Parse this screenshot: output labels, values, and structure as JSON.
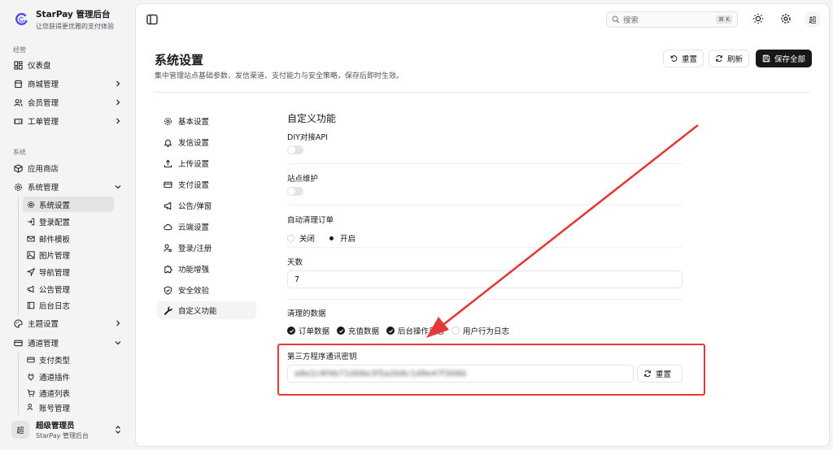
{
  "brand": {
    "name": "StarPay 管理后台",
    "tagline": "让您获得更优雅的支付体验"
  },
  "sidebar": {
    "sections": [
      {
        "label": "经营"
      },
      {
        "label": "系统"
      }
    ],
    "items": [
      {
        "label": "仪表盘",
        "icon": "dashboard-icon"
      },
      {
        "label": "商城管理",
        "icon": "store-icon"
      },
      {
        "label": "会员管理",
        "icon": "users-icon"
      },
      {
        "label": "工单管理",
        "icon": "ticket-icon"
      },
      {
        "label": "应用商店",
        "icon": "package-icon"
      },
      {
        "label": "系统管理",
        "icon": "gear-icon"
      },
      {
        "label": "主题设置",
        "icon": "palette-icon"
      },
      {
        "label": "通道管理",
        "icon": "credit-card-icon"
      }
    ],
    "system_sub": [
      {
        "label": "系统设置"
      },
      {
        "label": "登录配置"
      },
      {
        "label": "邮件模板"
      },
      {
        "label": "图片管理"
      },
      {
        "label": "导航管理"
      },
      {
        "label": "公告管理"
      },
      {
        "label": "后台日志"
      }
    ],
    "channel_sub": [
      {
        "label": "支付类型"
      },
      {
        "label": "通道插件"
      },
      {
        "label": "通道列表"
      },
      {
        "label": "账号管理"
      }
    ],
    "user": {
      "avatar": "超",
      "name": "超级管理员",
      "sub": "StarPay 管理后台"
    }
  },
  "topbar": {
    "search_placeholder": "搜索",
    "shortcut": "⌘ K",
    "avatar": "超"
  },
  "page": {
    "title": "系统设置",
    "description": "集中管理站点基础参数、发信渠道、支付能力与安全策略，保存后即时生效。",
    "buttons": {
      "reset": "重置",
      "refresh": "刷新",
      "save_all": "保存全部"
    }
  },
  "settings_menu": [
    {
      "label": "基本设置"
    },
    {
      "label": "发信设置"
    },
    {
      "label": "上传设置"
    },
    {
      "label": "支付设置"
    },
    {
      "label": "公告/弹窗"
    },
    {
      "label": "云端设置"
    },
    {
      "label": "登录/注册"
    },
    {
      "label": "功能增强"
    },
    {
      "label": "安全效验"
    },
    {
      "label": "自定义功能"
    }
  ],
  "custom": {
    "title": "自定义功能",
    "diy_api": {
      "label": "DIY对接API",
      "enabled": false
    },
    "maintenance": {
      "label": "站点维护",
      "enabled": false
    },
    "auto_clean": {
      "label": "自动清理订单",
      "options": [
        "关闭",
        "开启"
      ],
      "selected": "开启"
    },
    "days": {
      "label": "天数",
      "value": "7"
    },
    "clean_data": {
      "label": "清理的数据",
      "options": [
        {
          "label": "订单数据",
          "checked": true
        },
        {
          "label": "充值数据",
          "checked": true
        },
        {
          "label": "后台操作日志",
          "checked": true
        },
        {
          "label": "用户行为日志",
          "checked": false
        }
      ]
    },
    "secret": {
      "label": "第三方程序通讯密钥",
      "value": "a8e2c9f4b71d06e3f5a2b8c1d9e47f306b",
      "reset": "重置"
    }
  },
  "colors": {
    "accent": "#18181b",
    "annotation": "#e53935"
  }
}
